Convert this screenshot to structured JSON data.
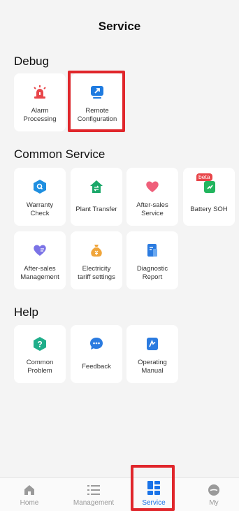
{
  "header": {
    "title": "Service"
  },
  "sections": {
    "debug": {
      "title": "Debug",
      "items": [
        {
          "label": "Alarm\nProcessing",
          "icon": "alarm-siren-icon"
        },
        {
          "label": "Remote\nConfiguration",
          "icon": "remote-monitor-icon"
        }
      ]
    },
    "common": {
      "title": "Common Service",
      "items": [
        {
          "label": "Warranty\nCheck",
          "icon": "warranty-shield-icon"
        },
        {
          "label": "Plant Transfer",
          "icon": "plant-transfer-icon"
        },
        {
          "label": "After-sales\nService",
          "icon": "heart-icon"
        },
        {
          "label": "Battery SOH",
          "icon": "battery-soh-icon",
          "badge": "beta"
        },
        {
          "label": "After-sales\nManagement",
          "icon": "heart-list-icon"
        },
        {
          "label": "Electricity\ntariff settings",
          "icon": "money-bag-icon"
        },
        {
          "label": "Diagnostic\nReport",
          "icon": "report-document-icon"
        }
      ]
    },
    "help": {
      "title": "Help",
      "items": [
        {
          "label": "Common\nProblem",
          "icon": "question-icon"
        },
        {
          "label": "Feedback",
          "icon": "chat-bubble-icon"
        },
        {
          "label": "Operating\nManual",
          "icon": "manual-book-icon"
        }
      ]
    }
  },
  "tabbar": {
    "items": [
      {
        "label": "Home",
        "icon": "home-icon"
      },
      {
        "label": "Management",
        "icon": "list-icon"
      },
      {
        "label": "Service",
        "icon": "service-grid-icon",
        "active": true
      },
      {
        "label": "My",
        "icon": "profile-icon"
      }
    ]
  },
  "colors": {
    "accent": "#1a73e8",
    "highlight": "#e0262b",
    "alarm": "#e8464a",
    "remote": "#1f7be0",
    "warranty": "#1f8fe0",
    "transfer": "#1ba86a",
    "heart": "#ef5f7a",
    "battery": "#22b55e",
    "purple": "#7b73e6",
    "money": "#f0a53a",
    "report": "#2b7be0",
    "question": "#1fae8a"
  }
}
